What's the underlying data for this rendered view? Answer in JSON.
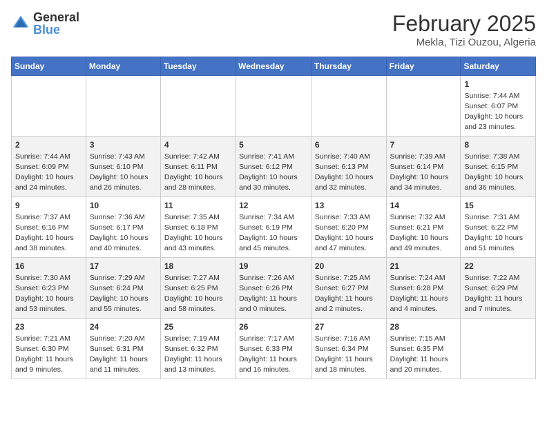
{
  "header": {
    "logo_general": "General",
    "logo_blue": "Blue",
    "title": "February 2025",
    "subtitle": "Mekla, Tizi Ouzou, Algeria"
  },
  "days_of_week": [
    "Sunday",
    "Monday",
    "Tuesday",
    "Wednesday",
    "Thursday",
    "Friday",
    "Saturday"
  ],
  "weeks": [
    [
      {
        "day": "",
        "info": ""
      },
      {
        "day": "",
        "info": ""
      },
      {
        "day": "",
        "info": ""
      },
      {
        "day": "",
        "info": ""
      },
      {
        "day": "",
        "info": ""
      },
      {
        "day": "",
        "info": ""
      },
      {
        "day": "1",
        "info": "Sunrise: 7:44 AM\nSunset: 6:07 PM\nDaylight: 10 hours and 23 minutes."
      }
    ],
    [
      {
        "day": "2",
        "info": "Sunrise: 7:44 AM\nSunset: 6:09 PM\nDaylight: 10 hours and 24 minutes."
      },
      {
        "day": "3",
        "info": "Sunrise: 7:43 AM\nSunset: 6:10 PM\nDaylight: 10 hours and 26 minutes."
      },
      {
        "day": "4",
        "info": "Sunrise: 7:42 AM\nSunset: 6:11 PM\nDaylight: 10 hours and 28 minutes."
      },
      {
        "day": "5",
        "info": "Sunrise: 7:41 AM\nSunset: 6:12 PM\nDaylight: 10 hours and 30 minutes."
      },
      {
        "day": "6",
        "info": "Sunrise: 7:40 AM\nSunset: 6:13 PM\nDaylight: 10 hours and 32 minutes."
      },
      {
        "day": "7",
        "info": "Sunrise: 7:39 AM\nSunset: 6:14 PM\nDaylight: 10 hours and 34 minutes."
      },
      {
        "day": "8",
        "info": "Sunrise: 7:38 AM\nSunset: 6:15 PM\nDaylight: 10 hours and 36 minutes."
      }
    ],
    [
      {
        "day": "9",
        "info": "Sunrise: 7:37 AM\nSunset: 6:16 PM\nDaylight: 10 hours and 38 minutes."
      },
      {
        "day": "10",
        "info": "Sunrise: 7:36 AM\nSunset: 6:17 PM\nDaylight: 10 hours and 40 minutes."
      },
      {
        "day": "11",
        "info": "Sunrise: 7:35 AM\nSunset: 6:18 PM\nDaylight: 10 hours and 43 minutes."
      },
      {
        "day": "12",
        "info": "Sunrise: 7:34 AM\nSunset: 6:19 PM\nDaylight: 10 hours and 45 minutes."
      },
      {
        "day": "13",
        "info": "Sunrise: 7:33 AM\nSunset: 6:20 PM\nDaylight: 10 hours and 47 minutes."
      },
      {
        "day": "14",
        "info": "Sunrise: 7:32 AM\nSunset: 6:21 PM\nDaylight: 10 hours and 49 minutes."
      },
      {
        "day": "15",
        "info": "Sunrise: 7:31 AM\nSunset: 6:22 PM\nDaylight: 10 hours and 51 minutes."
      }
    ],
    [
      {
        "day": "16",
        "info": "Sunrise: 7:30 AM\nSunset: 6:23 PM\nDaylight: 10 hours and 53 minutes."
      },
      {
        "day": "17",
        "info": "Sunrise: 7:29 AM\nSunset: 6:24 PM\nDaylight: 10 hours and 55 minutes."
      },
      {
        "day": "18",
        "info": "Sunrise: 7:27 AM\nSunset: 6:25 PM\nDaylight: 10 hours and 58 minutes."
      },
      {
        "day": "19",
        "info": "Sunrise: 7:26 AM\nSunset: 6:26 PM\nDaylight: 11 hours and 0 minutes."
      },
      {
        "day": "20",
        "info": "Sunrise: 7:25 AM\nSunset: 6:27 PM\nDaylight: 11 hours and 2 minutes."
      },
      {
        "day": "21",
        "info": "Sunrise: 7:24 AM\nSunset: 6:28 PM\nDaylight: 11 hours and 4 minutes."
      },
      {
        "day": "22",
        "info": "Sunrise: 7:22 AM\nSunset: 6:29 PM\nDaylight: 11 hours and 7 minutes."
      }
    ],
    [
      {
        "day": "23",
        "info": "Sunrise: 7:21 AM\nSunset: 6:30 PM\nDaylight: 11 hours and 9 minutes."
      },
      {
        "day": "24",
        "info": "Sunrise: 7:20 AM\nSunset: 6:31 PM\nDaylight: 11 hours and 11 minutes."
      },
      {
        "day": "25",
        "info": "Sunrise: 7:19 AM\nSunset: 6:32 PM\nDaylight: 11 hours and 13 minutes."
      },
      {
        "day": "26",
        "info": "Sunrise: 7:17 AM\nSunset: 6:33 PM\nDaylight: 11 hours and 16 minutes."
      },
      {
        "day": "27",
        "info": "Sunrise: 7:16 AM\nSunset: 6:34 PM\nDaylight: 11 hours and 18 minutes."
      },
      {
        "day": "28",
        "info": "Sunrise: 7:15 AM\nSunset: 6:35 PM\nDaylight: 11 hours and 20 minutes."
      },
      {
        "day": "",
        "info": ""
      }
    ]
  ]
}
